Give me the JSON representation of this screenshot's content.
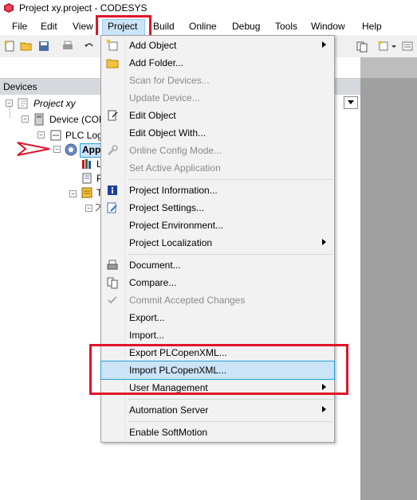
{
  "window": {
    "title": "Project xy.project - CODESYS"
  },
  "menubar": {
    "items": [
      {
        "label": "File"
      },
      {
        "label": "Edit"
      },
      {
        "label": "View"
      },
      {
        "label": "Project"
      },
      {
        "label": "Build"
      },
      {
        "label": "Online"
      },
      {
        "label": "Debug"
      },
      {
        "label": "Tools"
      },
      {
        "label": "Window"
      },
      {
        "label": "Help"
      }
    ]
  },
  "devices_panel": {
    "title": "Devices",
    "tree": [
      {
        "label": "Project xy"
      },
      {
        "label": "Device (CODE"
      },
      {
        "label": "PLC Logic"
      },
      {
        "label": "App"
      },
      {
        "label": "L"
      },
      {
        "label": "P"
      },
      {
        "label": "T"
      },
      {
        "label": ""
      }
    ]
  },
  "project_menu": {
    "items": [
      {
        "label": "Add Object",
        "disabled": false,
        "submenu": true,
        "icon": "add-object-icon"
      },
      {
        "label": "Add Folder...",
        "disabled": false,
        "submenu": false,
        "icon": "folder-icon"
      },
      {
        "label": "Scan for Devices...",
        "disabled": true,
        "submenu": false,
        "icon": ""
      },
      {
        "label": "Update Device...",
        "disabled": true,
        "submenu": false,
        "icon": ""
      },
      {
        "label": "Edit Object",
        "disabled": false,
        "submenu": false,
        "icon": "edit-object-icon"
      },
      {
        "label": "Edit Object With...",
        "disabled": false,
        "submenu": false,
        "icon": ""
      },
      {
        "label": "Online Config Mode...",
        "disabled": true,
        "submenu": false,
        "icon": "wrench-icon"
      },
      {
        "label": "Set Active Application",
        "disabled": true,
        "submenu": false,
        "icon": ""
      },
      {
        "label": "Project Information...",
        "disabled": false,
        "submenu": false,
        "icon": "info-icon"
      },
      {
        "label": "Project Settings...",
        "disabled": false,
        "submenu": false,
        "icon": "settings-icon"
      },
      {
        "label": "Project Environment...",
        "disabled": false,
        "submenu": false,
        "icon": ""
      },
      {
        "label": "Project Localization",
        "disabled": false,
        "submenu": true,
        "icon": ""
      },
      {
        "label": "Document...",
        "disabled": false,
        "submenu": false,
        "icon": "printer-icon"
      },
      {
        "label": "Compare...",
        "disabled": false,
        "submenu": false,
        "icon": "compare-icon"
      },
      {
        "label": "Commit Accepted Changes",
        "disabled": true,
        "submenu": false,
        "icon": "commit-icon"
      },
      {
        "label": "Export...",
        "disabled": false,
        "submenu": false,
        "icon": ""
      },
      {
        "label": "Import...",
        "disabled": false,
        "submenu": false,
        "icon": ""
      },
      {
        "label": "Export PLCopenXML...",
        "disabled": false,
        "submenu": false,
        "icon": ""
      },
      {
        "label": "Import PLCopenXML...",
        "disabled": false,
        "submenu": false,
        "icon": "",
        "selected": true
      },
      {
        "label": "User Management",
        "disabled": false,
        "submenu": true,
        "icon": ""
      },
      {
        "label": "Automation Server",
        "disabled": false,
        "submenu": true,
        "icon": ""
      },
      {
        "label": "Enable SoftMotion",
        "disabled": false,
        "submenu": false,
        "icon": ""
      }
    ]
  },
  "colors": {
    "highlight": "#e0142a",
    "selection": "#cce4f7",
    "selection_border": "#26a0da",
    "panel_header": "#d5d9dd"
  }
}
